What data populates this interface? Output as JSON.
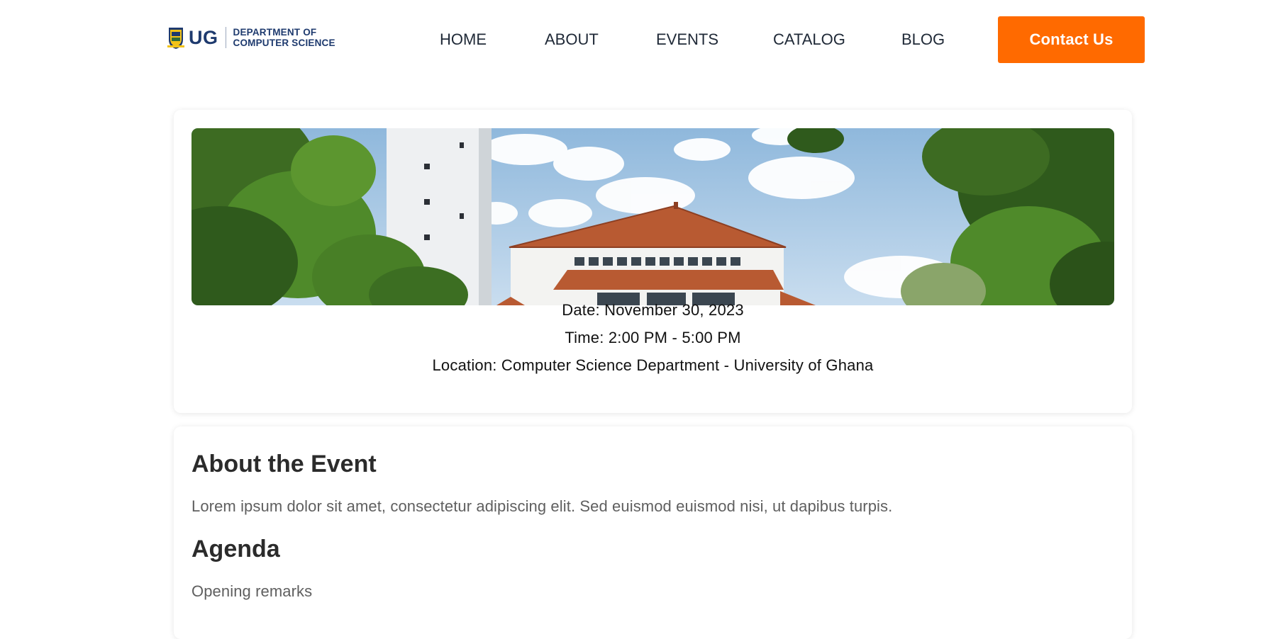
{
  "header": {
    "logo": {
      "short": "UG",
      "dept_line1": "DEPARTMENT OF",
      "dept_line2": "COMPUTER SCIENCE"
    },
    "nav": [
      {
        "label": "HOME"
      },
      {
        "label": "ABOUT"
      },
      {
        "label": "EVENTS"
      },
      {
        "label": "CATALOG"
      },
      {
        "label": "BLOG"
      }
    ],
    "contact_label": "Contact Us"
  },
  "event": {
    "date": "Date: November 30, 2023",
    "time": "Time: 2:00 PM - 5:00 PM",
    "location": "Location: Computer Science Department - University of Ghana"
  },
  "about": {
    "title": "About the Event",
    "text": "Lorem ipsum dolor sit amet, consectetur adipiscing elit. Sed euismod euismod nisi, ut dapibus turpis.",
    "agenda_title": "Agenda",
    "agenda_items": [
      "Opening remarks"
    ]
  },
  "colors": {
    "accent": "#ff6a00",
    "brand_blue": "#1e3a6e",
    "heading": "#2b2b2b",
    "body_text": "#5f5f5f"
  }
}
